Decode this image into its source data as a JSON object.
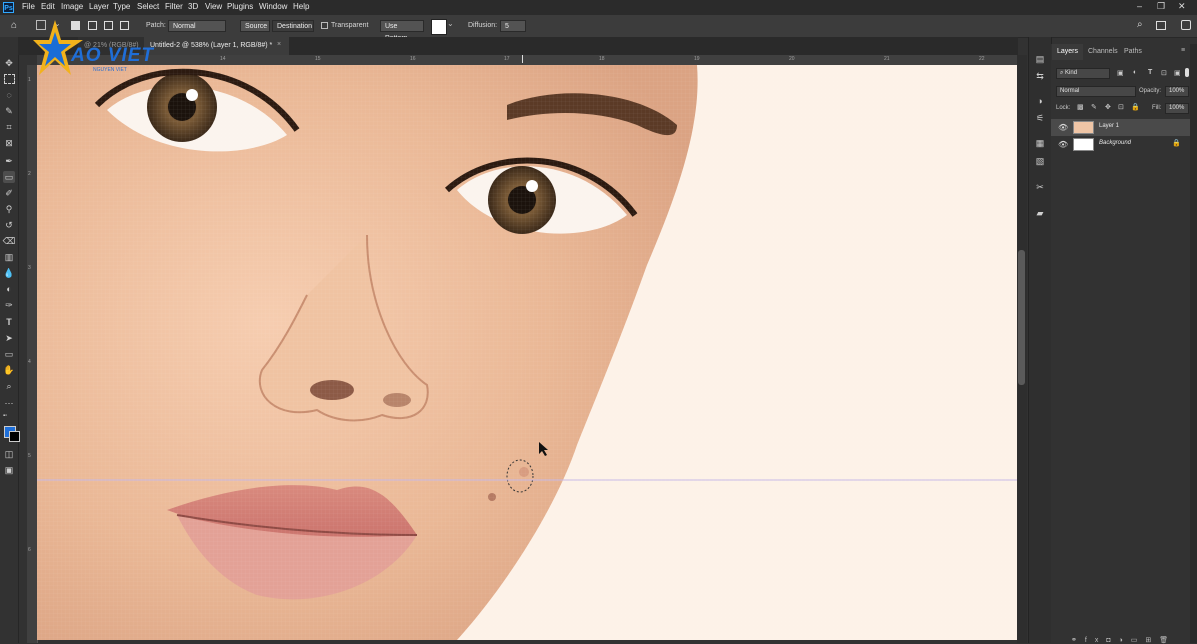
{
  "menubar": {
    "app_icon": "Ps",
    "items": [
      "File",
      "Edit",
      "Image",
      "Layer",
      "Type",
      "Select",
      "Filter",
      "3D",
      "View",
      "Plugins",
      "Window",
      "Help"
    ],
    "window_controls": [
      "–",
      "❐",
      "✕"
    ]
  },
  "options": {
    "patch_label": "Patch:",
    "patch_mode": "Normal",
    "source": "Source",
    "destination": "Destination",
    "transparent": "Transparent",
    "use_pattern": "Use Pattern",
    "diffusion_label": "Diffusion:",
    "diffusion_value": "5"
  },
  "tabs": [
    {
      "label": "@ 21% (RGB/8#) *",
      "active": false
    },
    {
      "label": "Untitled-2 @ 538% (Layer 1, RGB/8#) *",
      "active": true
    }
  ],
  "ruler": {
    "top_ticks": [
      "14",
      "15",
      "16",
      "17",
      "18",
      "19",
      "20",
      "21",
      "22"
    ],
    "left_ticks": [
      "1",
      "2",
      "3",
      "4",
      "5",
      "6",
      "7",
      "8"
    ]
  },
  "logo": {
    "text": "AO VIET",
    "subtext": "NGUYEN VIET"
  },
  "panels": {
    "tabs": [
      "Layers",
      "Channels",
      "Paths"
    ],
    "kind_filter": "Kind",
    "blend_mode": "Normal",
    "opacity_label": "Opacity:",
    "opacity_value": "100%",
    "lock_label": "Lock:",
    "fill_label": "Fill:",
    "fill_value": "100%",
    "layers": [
      {
        "name": "Layer 1",
        "selected": true
      },
      {
        "name": "Background",
        "selected": false
      }
    ]
  },
  "colors": {
    "foreground": "#1e6fd9",
    "background": "#000000",
    "accent": "#31a8ff"
  }
}
